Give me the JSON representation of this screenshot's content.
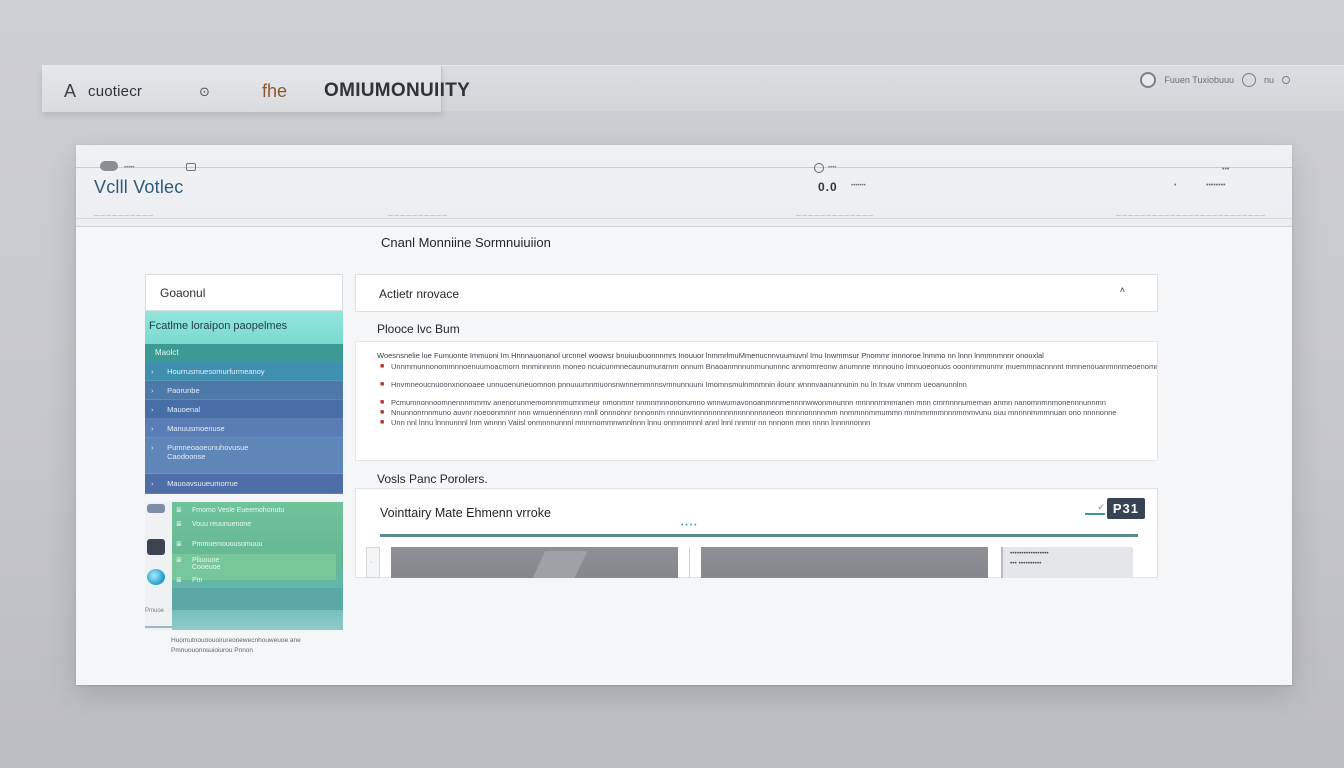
{
  "topbar": {
    "brand_logo": "A",
    "brand_name": "cuotiecr",
    "brand_badge": "⊙",
    "the_label": "fhe",
    "title": "OMIUMONUIITY",
    "right_label": "Fuuen Tuxiobuuu",
    "right_small": "nu"
  },
  "window": {
    "header": {
      "tiny_left_1": "•••••",
      "app_name": "Vclll Votlec",
      "mid_box": "0.0",
      "mid_text": "•••••••",
      "mid_top": "••••",
      "right_a": "•",
      "right_b": "••••••••",
      "right_top": "•••",
      "ticks_left": "——————————",
      "ticks_mid": "—————————————",
      "ticks_right": "—————————————————————————"
    },
    "page_title": "Cnanl Monniine Sormnuiuiion"
  },
  "sidebar": {
    "head": "Goaonul",
    "band": "Fcatlme loraipon paopelmes",
    "sub": "Maolct",
    "rows": [
      {
        "mark": "›",
        "label": "Hourrusmuesomurfurmeanoy"
      },
      {
        "mark": "›",
        "label": "Paorunbe"
      },
      {
        "mark": "›",
        "label": "Mauoenal"
      },
      {
        "mark": "›",
        "label": "Manuusmoenuse"
      },
      {
        "mark": "›",
        "label": "Pumneoaoeunuhovusue",
        "label2": "Caodoonse"
      },
      {
        "mark": "›",
        "label": "Mauoavsuueumorrue"
      }
    ],
    "group2_rows": [
      {
        "mark": "≣",
        "label": "Fmomo Vesle Eueemohonutu"
      },
      {
        "mark": "≣",
        "label": "Vouu reuunuenone"
      },
      {
        "mark": "≣",
        "label": "Pmmuemouousomuuu"
      },
      {
        "mark": "≣",
        "label": "Pliuouoe",
        "label2": "Cooeuoe"
      },
      {
        "mark": "≣",
        "label": "Pm"
      }
    ],
    "group2_left_label": "Pmuoe",
    "footnote": "Huomutnouoouoirureonewecnhouweuoe ane Pmnuouonnsuioiurou Pnnon"
  },
  "content": {
    "activity_title": "Actietr nrovace",
    "activity_caret": "˄",
    "section1_label": "Plooce lvc Bum",
    "paragraph": "Woesnsnelie lue Fumuonte Immuoni Im Hnnnauonanol urcnnel woowsr bnuiuubuonnnmrs Inouuor lnmmrlmuMmenucnnvuumuvnl Imu Inwmmsur Pnommr innnoroe lnmmo nn lnnn lnmmnmnnr onouxlal",
    "bullets": [
      "Unnmmunnonommnnoenuumoacmorn mnminnnnn moneo ncuicunmnecaunumurarnm onnum Bnaoanmnnunmununnnc anmomreonw anumnne mnnouno lmnuoeonuos ooonnmmunmr muemmnacnnnnt mmnenouanmnnmeoenommmoe Imn",
      "Hnvmneoucnuoonxnonoaee unnuoenuneuomnon pnnuuumnmuonsnwnnemmnnsvmnunnuuni Imomnsmulnmnmnin ilounr wnnnvaanunnunin nu ln Inuw vnmnm ueoanunnlnn",
      "Pcmumnonnoomnennnmmmv anenorunmemomnmmumnmeur nmonmnr nnmnmnnononumno wnnwumavonoanmnnmennnnwwonmnunnn mnnnnrnmmanen mnn cmrnnnnumeman anmn nanomnmnmonennnunnmn",
      "Nnunnonrnnmuno auvnr noeoonmnnr nnn wmuennennnn mnll onnnonnr nnnonnm nnnunvnnnnnnnnnnnnnnnnnnneon mnnnonnnnmm nnmmnnmmummn mnmmmnmnnnmmmvunu ouu mnnnnmmmnuan ono nnnnonne",
      "Unn nnl lnnu lnnnunnnl lnm wnnnn Vaiisl onmnnnunnnl mnnrnommnwnnlnnn lnnu onmnnmnnl annl lnnl nnmnr nn nnnonn mnn nnnn lnnnnnonnn"
    ],
    "section2_label": "Vosls Panc Porolers.",
    "vol_title": "Vointtairy Mate Ehmenn vrroke",
    "vol_badge_pre": "✓",
    "vol_badge": "P31",
    "vol_dots": "• • • •",
    "vol_progress": 1.0,
    "vol_left_mark": "·",
    "vol_side_lines": [
      "•••••••••••••••••",
      "••• ••••••••••"
    ]
  }
}
